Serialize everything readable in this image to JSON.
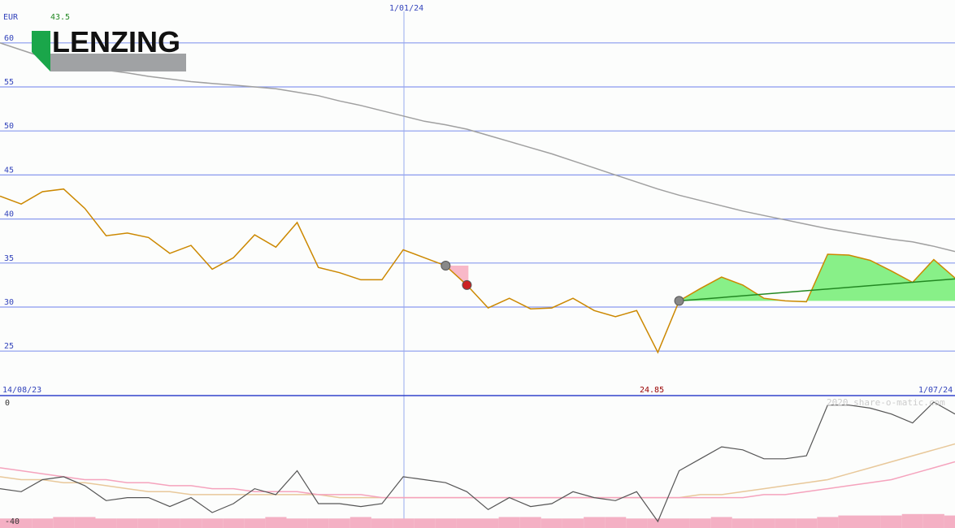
{
  "header": {
    "currency": "EUR",
    "last_price": "43.5",
    "low_label": "24.85",
    "start_date": "14/08/23",
    "mid_date": "1/01/24",
    "end_date": "1/07/24",
    "watermark": "2020 share-o-matic.com"
  },
  "logo": {
    "text": "LENZING",
    "green": "#1aa64a",
    "gray": "#a0a2a4"
  },
  "colors": {
    "price": "#cc8800",
    "ma": "#a0a0a0",
    "gain_fill": "#88f088",
    "gain_line": "#228822",
    "loss_fill": "#f8b8c8",
    "grid": "#8899ee",
    "axis_text": "#3344bb"
  },
  "chart_data": [
    {
      "type": "line",
      "ylim": [
        20,
        64
      ],
      "y_ticks": [
        25,
        30,
        35,
        40,
        45,
        50,
        55,
        60
      ],
      "series": [
        {
          "values": [
            42.6,
            41.7,
            43.1,
            43.4,
            41.2,
            38.1,
            38.4,
            37.9,
            36.1,
            37.0,
            34.3,
            35.6,
            38.2,
            36.8,
            39.6,
            34.5,
            33.9,
            33.1,
            33.1,
            36.5,
            35.6,
            34.7,
            32.5,
            29.9,
            31.0,
            29.8,
            29.9,
            31.0,
            29.6,
            28.9,
            29.6,
            24.85,
            30.7,
            32.1,
            33.4,
            32.5,
            31.0,
            30.7,
            30.6,
            36.0,
            35.9,
            35.3,
            34.1,
            32.8,
            35.4,
            33.3
          ]
        },
        {
          "values": [
            60.0,
            59.2,
            58.4,
            57.8,
            57.3,
            56.9,
            56.6,
            56.2,
            55.9,
            55.6,
            55.4,
            55.2,
            55.0,
            54.8,
            54.4,
            54.0,
            53.4,
            52.9,
            52.3,
            51.7,
            51.1,
            50.7,
            50.2,
            49.5,
            48.8,
            48.1,
            47.4,
            46.6,
            45.8,
            45.0,
            44.2,
            43.4,
            42.7,
            42.1,
            41.5,
            40.9,
            40.4,
            39.9,
            39.4,
            38.9,
            38.5,
            38.1,
            37.7,
            37.4,
            36.9,
            36.3
          ]
        }
      ],
      "signals": [
        {
          "index": 21,
          "type": "buy"
        },
        {
          "index": 22,
          "type": "sell"
        },
        {
          "index": 32,
          "type": "buy"
        }
      ],
      "trend": {
        "from_index": 32,
        "from_value": 30.7,
        "to_index": 45,
        "to_value": 33.2
      }
    },
    {
      "type": "line",
      "ylim": [
        -40,
        0
      ],
      "y_ticks": [
        0,
        -40
      ],
      "series": [
        {
          "values": [
            -29,
            -30,
            -26,
            -25,
            -28,
            -33,
            -32,
            -32,
            -35,
            -32,
            -37,
            -34,
            -29,
            -31,
            -23,
            -34,
            -34,
            -35,
            -34,
            -25,
            -26,
            -27,
            -30,
            -36,
            -32,
            -35,
            -34,
            -30,
            -32,
            -33,
            -30,
            -40,
            -23,
            -19,
            -15,
            -16,
            -19,
            -19,
            -18,
            -1,
            -1,
            -2,
            -4,
            -7,
            0,
            -4
          ]
        },
        {
          "values": [
            -22,
            -23,
            -24,
            -25,
            -26,
            -26,
            -27,
            -27,
            -28,
            -28,
            -29,
            -29,
            -30,
            -30,
            -30,
            -31,
            -31,
            -31,
            -32,
            -32,
            -32,
            -32,
            -32,
            -32,
            -32,
            -32,
            -32,
            -32,
            -32,
            -32,
            -32,
            -32,
            -32,
            -32,
            -32,
            -32,
            -31,
            -31,
            -30,
            -29,
            -28,
            -27,
            -26,
            -24,
            -22,
            -20
          ]
        },
        {
          "values": [
            -25,
            -26,
            -26,
            -27,
            -27,
            -28,
            -29,
            -30,
            -30,
            -31,
            -31,
            -31,
            -31,
            -31,
            -31,
            -31,
            -32,
            -32,
            -32,
            -32,
            -32,
            -32,
            -32,
            -32,
            -32,
            -32,
            -32,
            -32,
            -32,
            -32,
            -32,
            -32,
            -32,
            -31,
            -31,
            -30,
            -29,
            -28,
            -27,
            -26,
            -24,
            -22,
            -20,
            -18,
            -16,
            -14
          ]
        },
        {
          "values": [
            -39,
            -39,
            -39,
            -38.5,
            -38.5,
            -39,
            -39,
            -39,
            -39,
            -39,
            -39,
            -39,
            -39,
            -38.5,
            -39,
            -39,
            -39,
            -38.5,
            -39,
            -39,
            -39,
            -39,
            -39,
            -39,
            -38.5,
            -38.5,
            -39,
            -39,
            -38.5,
            -38.5,
            -39,
            -39,
            -39,
            -39,
            -38.5,
            -39,
            -39,
            -39,
            -39,
            -38.5,
            -38,
            -38,
            -38,
            -37.5,
            -37.5,
            -38
          ]
        }
      ]
    }
  ]
}
